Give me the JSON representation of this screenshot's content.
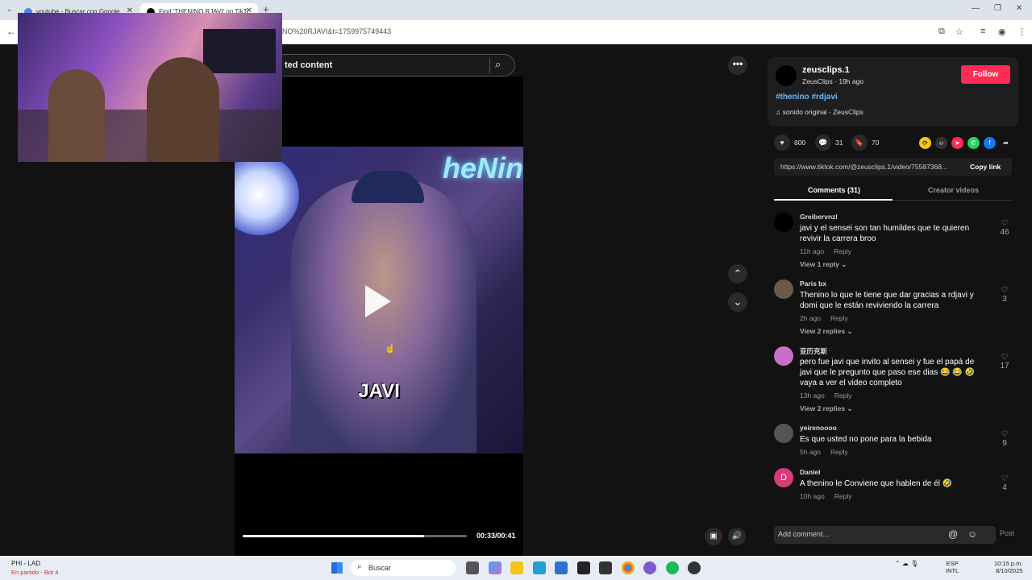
{
  "browser": {
    "tabs": [
      {
        "label": "youtube - Buscar con Google"
      },
      {
        "label": "Find 'THENINO RJAVI' on TikTok"
      }
    ],
    "url": "NO%20RJAVI&t=1759975749443"
  },
  "search": {
    "text": "ted content"
  },
  "video": {
    "caption": "JAVI",
    "neon_text": "heNin",
    "time": "00:33/00:41",
    "progress_fraction": 0.81
  },
  "author": {
    "username": "zeusclips.1",
    "subname": "ZeusClips · 19h ago",
    "follow_label": "Follow",
    "hashtags": "#thenino #rdjavi",
    "music": "sonido original - ZeusClips"
  },
  "stats": {
    "likes": "800",
    "comments": "31",
    "saves": "70"
  },
  "link": {
    "url": "https://www.tiktok.com/@zeusclips.1/video/75587368...",
    "copy_label": "Copy link"
  },
  "comment_tabs": {
    "comments": "Comments (31)",
    "creator": "Creator videos"
  },
  "comments": [
    {
      "name": "Greibervnzl",
      "text": "javi y el sensei son tan humildes que te quieren revivir la carrera broo",
      "time": "11h ago",
      "reply": "Reply",
      "view": "View 1 reply",
      "likes": "46",
      "avatar": "#000000"
    },
    {
      "name": "Paris bx",
      "text": "Thenino lo que le tiene que dar gracias a rdjavi y domi que le están reviviendo la carrera",
      "time": "2h ago",
      "reply": "Reply",
      "view": "View 2 replies",
      "likes": "3",
      "avatar": "#6b5a4a"
    },
    {
      "name": "亚历克斯",
      "text": "pero fue javi que invito al sensei y fue el papá de javi que le pregunto que paso ese dias 😂 😂 🤣 vaya a ver el video completo",
      "time": "13h ago",
      "reply": "Reply",
      "view": "View 2 replies",
      "likes": "17",
      "avatar": "#c86fc9"
    },
    {
      "name": "yeirenoooo",
      "text": "Es que usted no pone para la bebida",
      "time": "5h ago",
      "reply": "Reply",
      "view": "",
      "likes": "9",
      "avatar": "#555555"
    },
    {
      "name": "Daniel",
      "text": "A thenino le Conviene que hablen de él 🤣",
      "time": "10h ago",
      "reply": "Reply",
      "view": "",
      "likes": "4",
      "avatar": "#d63b7a",
      "initial": "D"
    }
  ],
  "add_comment": {
    "placeholder": "Add comment...",
    "post": "Post"
  },
  "taskbar": {
    "sports_title": "PHI - LAD",
    "sports_sub": "En partido - Bot 4",
    "search": "Buscar",
    "lang1": "ESP",
    "lang2": "INTL",
    "time": "10:15 p.m.",
    "date": "8/10/2025"
  }
}
